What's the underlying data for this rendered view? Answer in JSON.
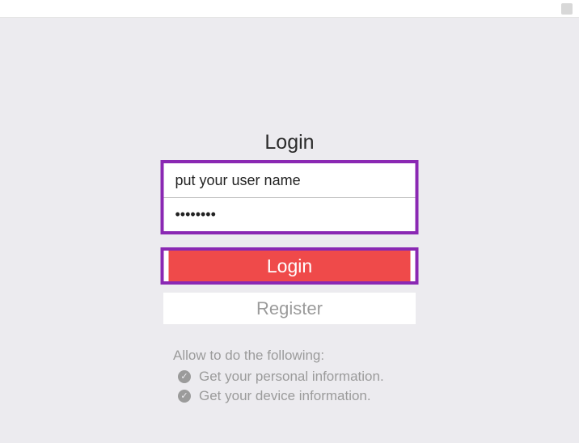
{
  "topbar": {
    "badge": ""
  },
  "title": "Login",
  "form": {
    "username_placeholder": "put your user name",
    "username_value": "",
    "password_value": "••••••••"
  },
  "buttons": {
    "login": "Login",
    "register": "Register"
  },
  "permissions": {
    "title": "Allow to do the following:",
    "items": [
      "Get your personal information.",
      "Get your device information."
    ]
  },
  "colors": {
    "highlight_border": "#8a28b3",
    "primary_button": "#ef4a4a",
    "stage_bg": "#ecebef"
  }
}
